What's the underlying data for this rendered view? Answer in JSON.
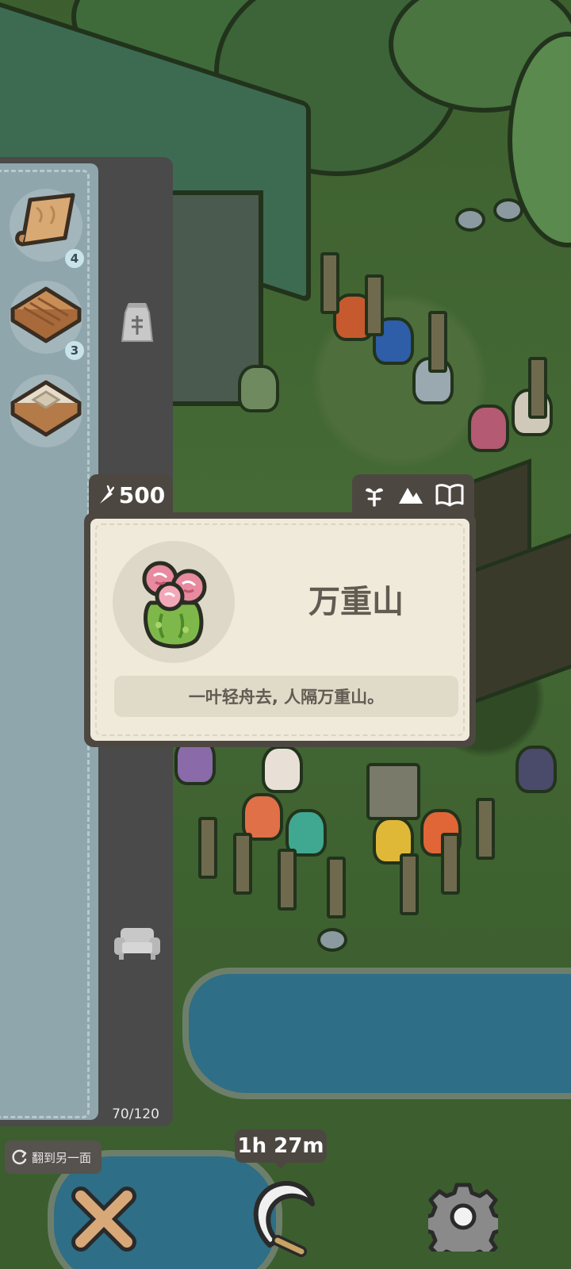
{
  "inventory": {
    "items": [
      {
        "name": "wood-scroll",
        "count": "4"
      },
      {
        "name": "wooden-tile",
        "count": "3"
      },
      {
        "name": "stone-tile",
        "count": ""
      }
    ],
    "category_icons": [
      "seed-bag-icon",
      "sofa-icon"
    ],
    "capacity": "70/120"
  },
  "item_card": {
    "cost_icon": "carrot-icon",
    "cost": "500",
    "tab_icons": [
      "sprout-icon",
      "mountain-icon",
      "book-icon"
    ],
    "name": "万重山",
    "description": "一叶轻舟去, 人隔万重山。",
    "image": "pink-flower-cactus"
  },
  "bottom_bar": {
    "flip_label": "翻到另一面",
    "timer": "1h 27m",
    "close_icon": "close-x-icon",
    "harvest_icon": "sickle-icon",
    "settings_icon": "gear-icon"
  }
}
